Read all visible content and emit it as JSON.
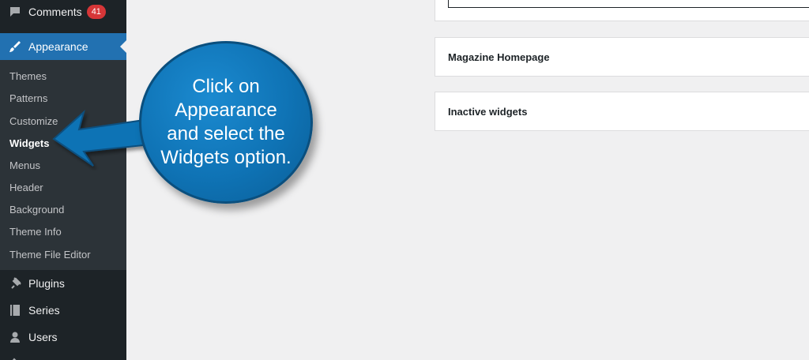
{
  "sidebar": {
    "comments": {
      "label": "Comments",
      "badge": "41"
    },
    "appearance": {
      "label": "Appearance"
    },
    "submenu": [
      "Themes",
      "Patterns",
      "Customize",
      "Widgets",
      "Menus",
      "Header",
      "Background",
      "Theme Info",
      "Theme File Editor"
    ],
    "bottom_items": [
      {
        "label": "Plugins",
        "icon": "plugin-icon"
      },
      {
        "label": "Series",
        "icon": "book-icon"
      },
      {
        "label": "Users",
        "icon": "user-icon"
      }
    ]
  },
  "main": {
    "widget_areas": [
      "Magazine Homepage",
      "Inactive widgets"
    ]
  },
  "callout": {
    "text": "Click on Appearance and select the Widgets option."
  },
  "colors": {
    "sidebar_bg": "#1d2327",
    "submenu_bg": "#2c3338",
    "accent": "#2271b1",
    "badge": "#d63638",
    "callout": "#0f73b5"
  }
}
